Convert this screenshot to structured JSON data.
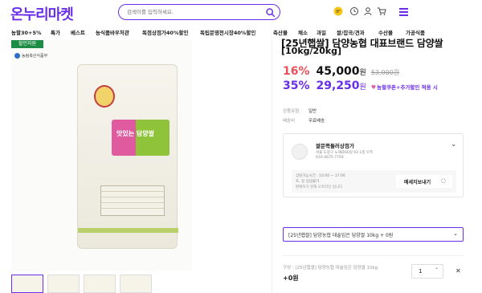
{
  "header": {
    "logo": "온누리마켓",
    "search_placeholder": "검색어를 입력하세요.",
    "icons": [
      "chat-icon",
      "clock-icon",
      "user-icon",
      "cart-icon",
      "menu-icon"
    ]
  },
  "nav": {
    "items": [
      "농할30+5%",
      "특가",
      "베스트",
      "농식품바우처관",
      "독점상점가40%할인",
      "독립문영천시장40%할인",
      "축산물",
      "채소",
      "과일",
      "쌀/잡곡/견과",
      "수산물",
      "가공식품"
    ]
  },
  "product_image": {
    "badge": "할인지원",
    "org_label": "농림축산식품부",
    "bag_label": "맛있는 담양쌀"
  },
  "product": {
    "title_line1": "[25년햅쌀] 담양농협 대표브랜드 담양쌀",
    "title_line2": "[10kg/20kg]",
    "discount1_pct": "16%",
    "price1": "45,000",
    "price1_unit": "원",
    "orig_price": "53,000원",
    "discount2_pct": "35%",
    "price2": "29,250",
    "price2_unit": "원",
    "coupon_text": "농할쿠폰+추가할인 적용 시",
    "meta": [
      {
        "k": "상품유형",
        "v": "일반"
      },
      {
        "k": "배송비",
        "v": "무료배송"
      }
    ]
  },
  "shop": {
    "name": "쌀문쪽돌러상점가",
    "address": "서울 도봉구 노해로60길 93 1층 우측",
    "tel": "010-4675-7793",
    "hours": "상담가능시간 : 10:00 ~ 17:00",
    "holiday": "토, 일 상담불가",
    "notice": "판매자가 현재 오프라인 입니다",
    "msg_button": "메세지보내기"
  },
  "option": {
    "selected": "[25년햅쌀] 담양농협 대술임은 담양쌀 10kg + 0원",
    "sel_label": "구성 : [25년햅쌀] 담양농협 대술임은 담양쌀 10kg",
    "sel_price": "+0원",
    "qty": "1"
  },
  "colors": {
    "accent": "#6a2ee8",
    "discount_red": "#e8505b"
  }
}
